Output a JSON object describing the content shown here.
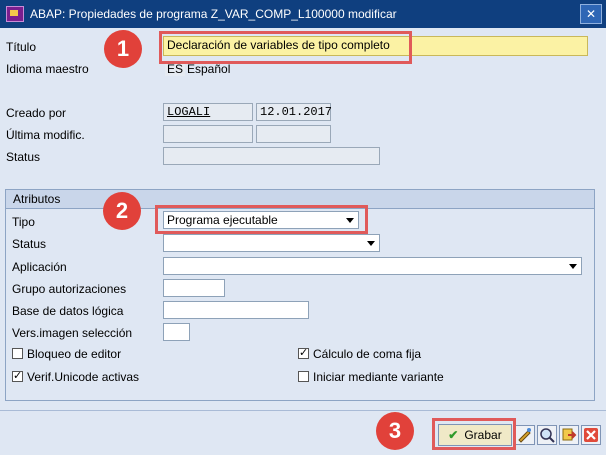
{
  "window": {
    "title": "ABAP: Propiedades de programa Z_VAR_COMP_L100000 modificar"
  },
  "header": {
    "titulo_label": "Título",
    "titulo_value": "Declaración de variables de tipo completo",
    "idioma_label": "Idioma maestro",
    "idioma_code": "ES",
    "idioma_name": "Español",
    "creado_label": "Creado por",
    "creado_user": "LOGALI",
    "creado_date": "12.01.2017",
    "ultima_label": "Última modific.",
    "status_label": "Status"
  },
  "atributos": {
    "title": "Atributos",
    "tipo_label": "Tipo",
    "tipo_value": "Programa ejecutable",
    "status_label": "Status",
    "aplicacion_label": "Aplicación",
    "grupo_label": "Grupo autorizaciones",
    "base_label": "Base de datos lógica",
    "vers_label": "Vers.imagen selección",
    "bloqueo_label": "Bloqueo de editor",
    "bloqueo_checked": false,
    "calculo_label": "Cálculo de coma fija",
    "calculo_checked": true,
    "unicode_label": "Verif.Unicode activas",
    "unicode_checked": true,
    "iniciar_label": "Iniciar mediante variante",
    "iniciar_checked": false
  },
  "toolbar": {
    "save_label": "Grabar"
  },
  "annotations": {
    "badge1": "1",
    "badge2": "2",
    "badge3": "3"
  },
  "colors": {
    "highlight": "#e05a5a",
    "badge": "#e1413a",
    "titlebar": "#0f3f7f"
  }
}
